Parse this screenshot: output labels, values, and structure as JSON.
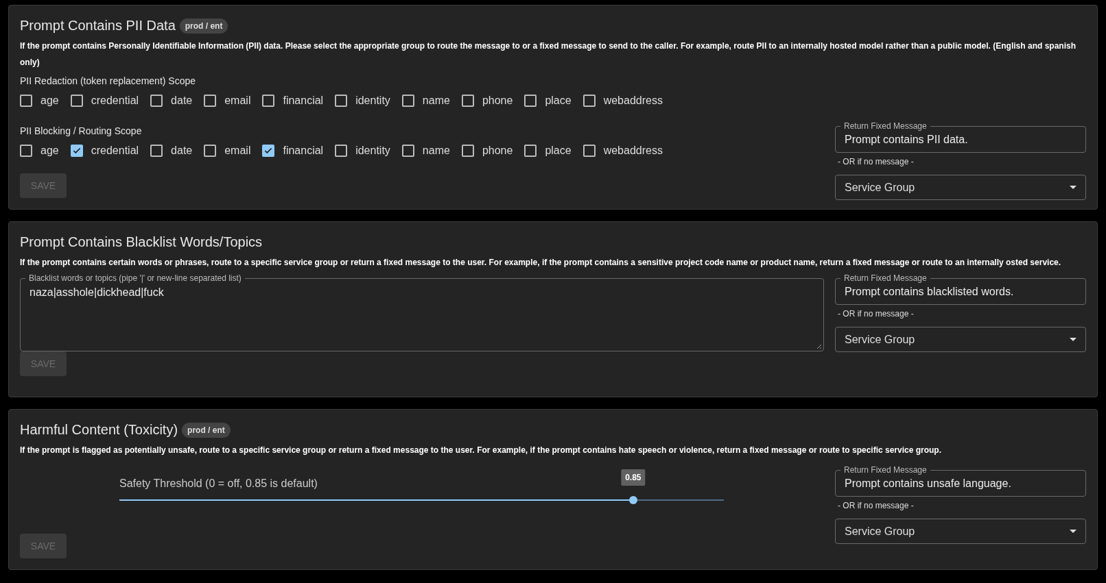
{
  "sections": [
    {
      "kind": "pii",
      "title": "Prompt Contains PII Data",
      "badge": "prod / ent",
      "description": "If the prompt contains Personally Identifiable Information (PII) data. Please select the appropriate group to route the message to or a fixed message to send to the caller. For example, route PII to an internally hosted model rather than a public model. (English and spanish only)",
      "scopes": [
        {
          "label": "PII Redaction (token replacement) Scope",
          "options": [
            {
              "label": "age",
              "checked": false
            },
            {
              "label": "credential",
              "checked": false
            },
            {
              "label": "date",
              "checked": false
            },
            {
              "label": "email",
              "checked": false
            },
            {
              "label": "financial",
              "checked": false
            },
            {
              "label": "identity",
              "checked": false
            },
            {
              "label": "name",
              "checked": false
            },
            {
              "label": "phone",
              "checked": false
            },
            {
              "label": "place",
              "checked": false
            },
            {
              "label": "webaddress",
              "checked": false
            }
          ]
        },
        {
          "label": "PII Blocking / Routing Scope",
          "options": [
            {
              "label": "age",
              "checked": false
            },
            {
              "label": "credential",
              "checked": true
            },
            {
              "label": "date",
              "checked": false
            },
            {
              "label": "email",
              "checked": false
            },
            {
              "label": "financial",
              "checked": true
            },
            {
              "label": "identity",
              "checked": false
            },
            {
              "label": "name",
              "checked": false
            },
            {
              "label": "phone",
              "checked": false
            },
            {
              "label": "place",
              "checked": false
            },
            {
              "label": "webaddress",
              "checked": false
            }
          ]
        }
      ],
      "fixed_message": {
        "label": "Return Fixed Message",
        "value": "Prompt contains PII data."
      },
      "or_text": "- OR if no message -",
      "service_group": {
        "label": "Service Group"
      },
      "save": {
        "label": "SAVE",
        "disabled": true
      }
    },
    {
      "kind": "blacklist",
      "title": "Prompt Contains Blacklist Words/Topics",
      "description": "If the prompt contains certain words or phrases, route to a specific service group or return a fixed message to the user. For example, if the prompt contains a sensitive project code name or product name, return a fixed message or route to an internally osted service.",
      "words": {
        "label": "Blacklist words or topics (pipe '|' or new-line separated list)",
        "value": "naza|asshole|dickhead|fuck"
      },
      "fixed_message": {
        "label": "Return Fixed Message",
        "value": "Prompt contains blacklisted words."
      },
      "or_text": "- OR if no message -",
      "service_group": {
        "label": "Service Group"
      },
      "save": {
        "label": "SAVE",
        "disabled": true
      }
    },
    {
      "kind": "toxicity",
      "title": "Harmful Content (Toxicity)",
      "badge": "prod / ent",
      "description": "If the prompt is flagged as potentially unsafe, route to a specific service group or return a fixed message to the user. For example, if the prompt contains hate speech or violence, return a fixed message or route to specific service group.",
      "slider": {
        "label": "Safety Threshold (0 = off, 0.85 is default)",
        "level": 0.85,
        "reading": "0.85"
      },
      "fixed_message": {
        "label": "Return Fixed Message",
        "value": "Prompt contains unsafe language."
      },
      "or_text": "- OR if no message -",
      "service_group": {
        "label": "Service Group"
      },
      "save": {
        "label": "SAVE",
        "disabled": true
      }
    }
  ]
}
